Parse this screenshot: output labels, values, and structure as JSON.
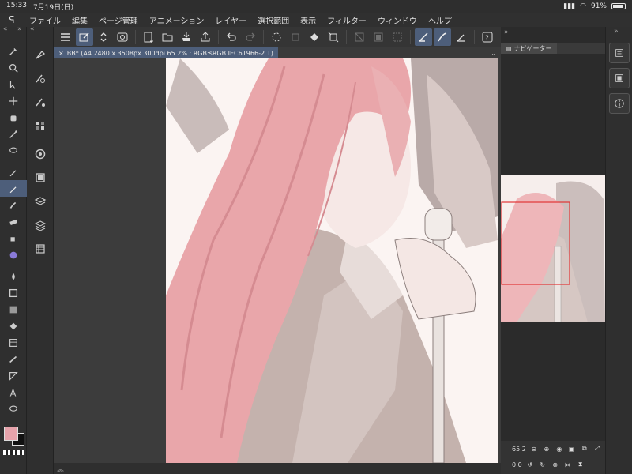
{
  "status": {
    "time": "15:33",
    "date": "7月19日(日)",
    "battery": "91%"
  },
  "menu": [
    "ファイル",
    "編集",
    "ページ管理",
    "アニメーション",
    "レイヤー",
    "選択範囲",
    "表示",
    "フィルター",
    "ウィンドウ",
    "ヘルプ"
  ],
  "document": {
    "tab_label": "BB* (A4 2480 x 3508px 300dpi 65.2% : RGB:sRGB IEC61966-2.1)"
  },
  "navigator": {
    "tab_label": "ナビゲーター",
    "zoom": "65.2",
    "rotation": "0.0"
  },
  "colors": {
    "foreground": "#e6a3ab",
    "background": "#111111",
    "accent": "#4d5e7a"
  },
  "left_tools": [
    "brush-icon",
    "zoom-icon",
    "operation-icon",
    "move-icon",
    "hand-icon",
    "magic-wand-icon",
    "lasso-icon",
    "pen-icon",
    "pencil-icon",
    "brush-icon",
    "eraser-icon",
    "airbrush-icon",
    "blend-icon",
    "fill-icon",
    "rectangle-icon",
    "gradient-icon",
    "bucket-icon",
    "frame-icon",
    "balloon-icon",
    "ruler-icon",
    "text-icon",
    "speech-icon"
  ],
  "sub_tools": [
    "sub-tool-icon",
    "tool-property-icon",
    "brush-size-icon",
    "color-wheel-icon",
    "color-set-icon",
    "layer-property-icon",
    "layer-icon",
    "material-icon"
  ]
}
